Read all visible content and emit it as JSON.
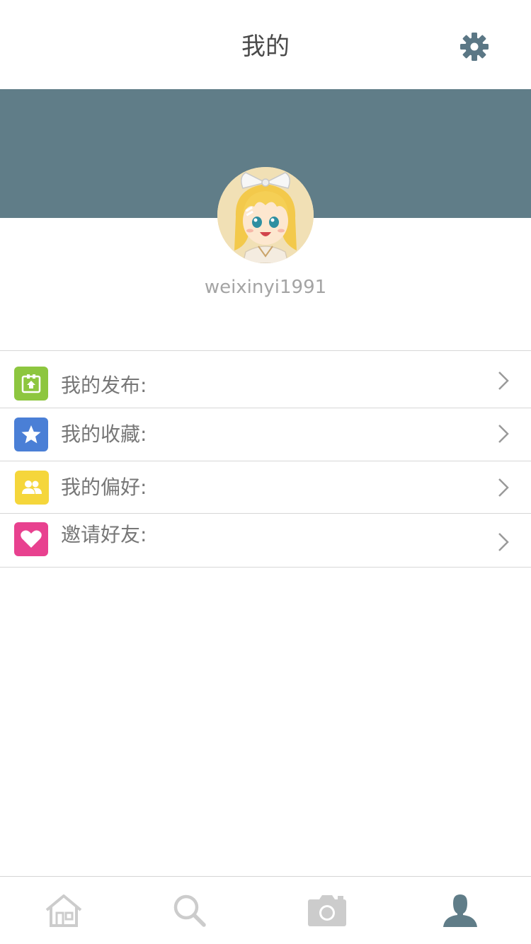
{
  "header": {
    "title": "我的",
    "settings_icon": "gear-icon"
  },
  "profile": {
    "username": "weixinyi1991",
    "banner_color": "#607d88"
  },
  "menu": {
    "items": [
      {
        "label": "我的发布:",
        "icon": "publish-icon",
        "icon_color": "#8dc63f"
      },
      {
        "label": "我的收藏:",
        "icon": "star-icon",
        "icon_color": "#4a7fd6"
      },
      {
        "label": "我的偏好:",
        "icon": "people-icon",
        "icon_color": "#f5d63b"
      },
      {
        "label": "邀请好友:",
        "icon": "heart-icon",
        "icon_color": "#e8418f"
      }
    ]
  },
  "tabbar": {
    "tabs": [
      {
        "icon": "home-icon",
        "active": false
      },
      {
        "icon": "search-icon",
        "active": false
      },
      {
        "icon": "camera-icon",
        "active": false
      },
      {
        "icon": "user-icon",
        "active": true
      }
    ],
    "active_color": "#607d88",
    "inactive_color": "#cccccc"
  }
}
